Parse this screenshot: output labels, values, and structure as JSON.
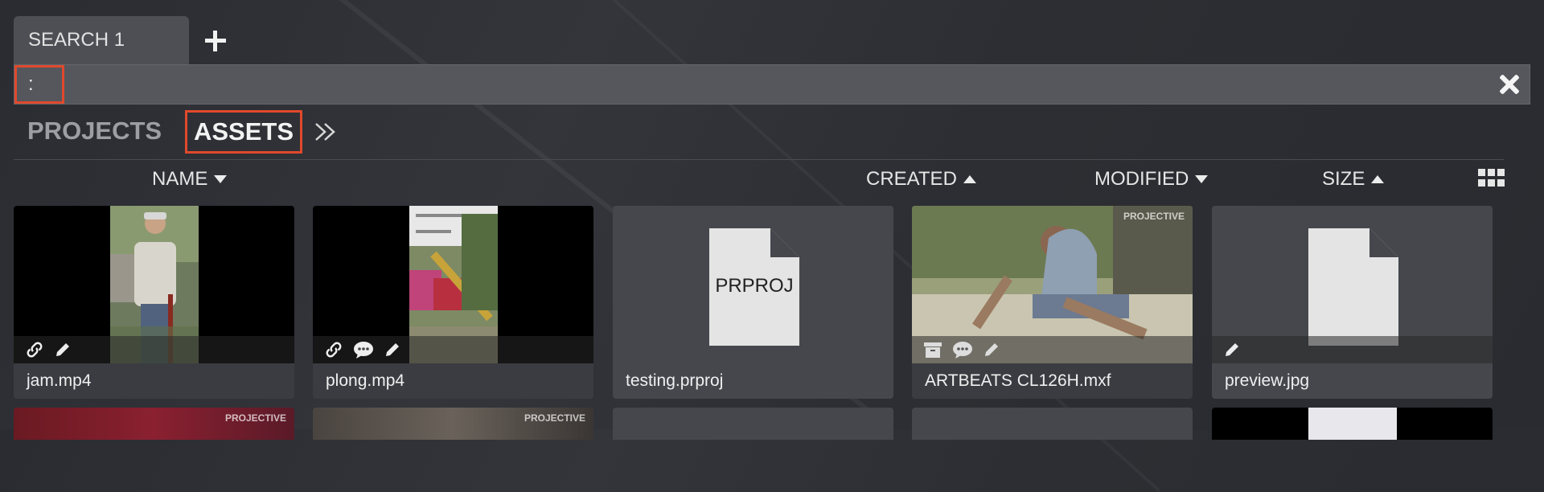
{
  "tabs": {
    "search_tab_label": "SEARCH 1"
  },
  "search": {
    "query": ":"
  },
  "nav": {
    "projects_label": "PROJECTS",
    "assets_label": "ASSETS"
  },
  "columns": {
    "name": "NAME",
    "created": "CREATED",
    "modified": "MODIFIED",
    "size": "SIZE"
  },
  "assets": [
    {
      "filename": "jam.mp4",
      "icons": [
        "link-icon",
        "pencil-icon"
      ]
    },
    {
      "filename": "plong.mp4",
      "icons": [
        "link-icon",
        "comment-icon",
        "pencil-icon"
      ]
    },
    {
      "filename": "testing.prproj",
      "file_type_label": "PRPROJ",
      "icons": []
    },
    {
      "filename": "ARTBEATS CL126H.mxf",
      "watermark": "PROJECTIVE",
      "icons": [
        "archive-icon",
        "comment-icon",
        "pencil-icon"
      ]
    },
    {
      "filename": "preview.jpg",
      "icons": [
        "pencil-icon"
      ]
    }
  ],
  "row2_watermarks": [
    "PROJECTIVE",
    "PROJECTIVE"
  ],
  "colors": {
    "accent_highlight": "#e0492c",
    "background": "#2c2e33",
    "card": "#3a3c41"
  }
}
